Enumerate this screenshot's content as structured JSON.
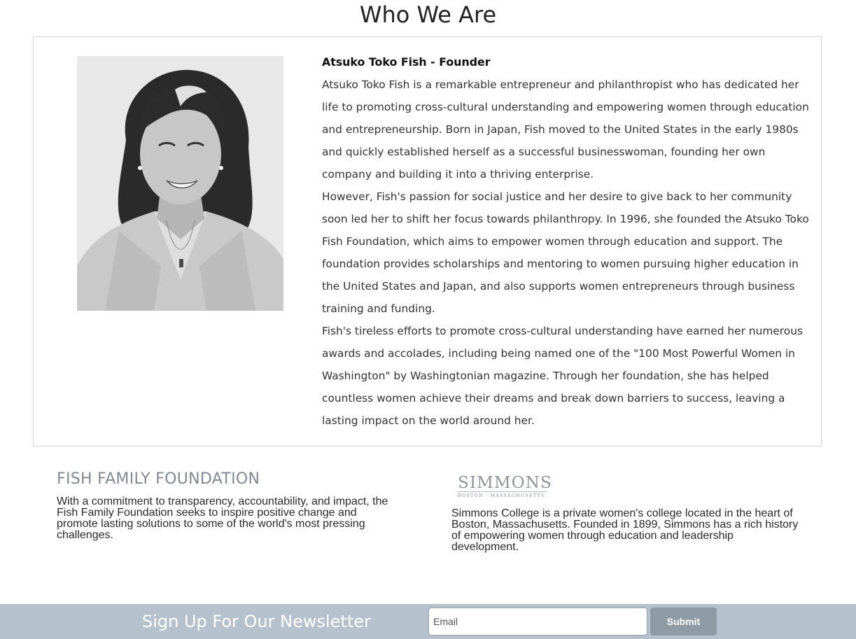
{
  "header": {
    "title": "Who We Are"
  },
  "founder": {
    "heading": "Atsuko Toko Fish - Founder",
    "paragraphs": [
      "Atsuko Toko Fish is a remarkable entrepreneur and philanthropist who has dedicated her life to promoting cross-cultural understanding and empowering women through education and entrepreneurship. Born in Japan, Fish moved to the United States in the early 1980s and quickly established herself as a successful businesswoman, founding her own company and building it into a thriving enterprise.",
      "However, Fish's passion for social justice and her desire to give back to her community soon led her to shift her focus towards philanthropy. In 1996, she founded the Atsuko Toko Fish Foundation, which aims to empower women through education and support. The foundation provides scholarships and mentoring to women pursuing higher education in the United States and Japan, and also supports women entrepreneurs through business training and funding.",
      "Fish's tireless efforts to promote cross-cultural understanding have earned her numerous awards and accolades, including being named one of the \"100 Most Powerful Women in Washington\" by Washingtonian magazine. Through her foundation, she has helped countless women achieve their dreams and break down barriers to success, leaving a lasting impact on the world around her."
    ]
  },
  "foundation": {
    "title": "FISH FAMILY FOUNDATION",
    "description": "With a commitment to transparency, accountability, and impact, the Fish Family Foundation seeks to inspire positive change and promote lasting solutions to some of the world's most pressing challenges."
  },
  "simmons": {
    "logo_word": "SIMMONS",
    "logo_sub": "BOSTON · MASSACHUSETTS",
    "description": "Simmons College is a private women's college located in the heart of Boston, Massachusetts. Founded in 1899, Simmons has a rich history of empowering women through education and leadership development."
  },
  "newsletter": {
    "label": "Sign Up For Our Newsletter",
    "email_placeholder": "Email",
    "submit_label": "Submit"
  },
  "colors": {
    "newsletter_bg": "#b5c2cd",
    "submit_bg": "#8e9aa4",
    "foundation_title": "#808a94"
  }
}
